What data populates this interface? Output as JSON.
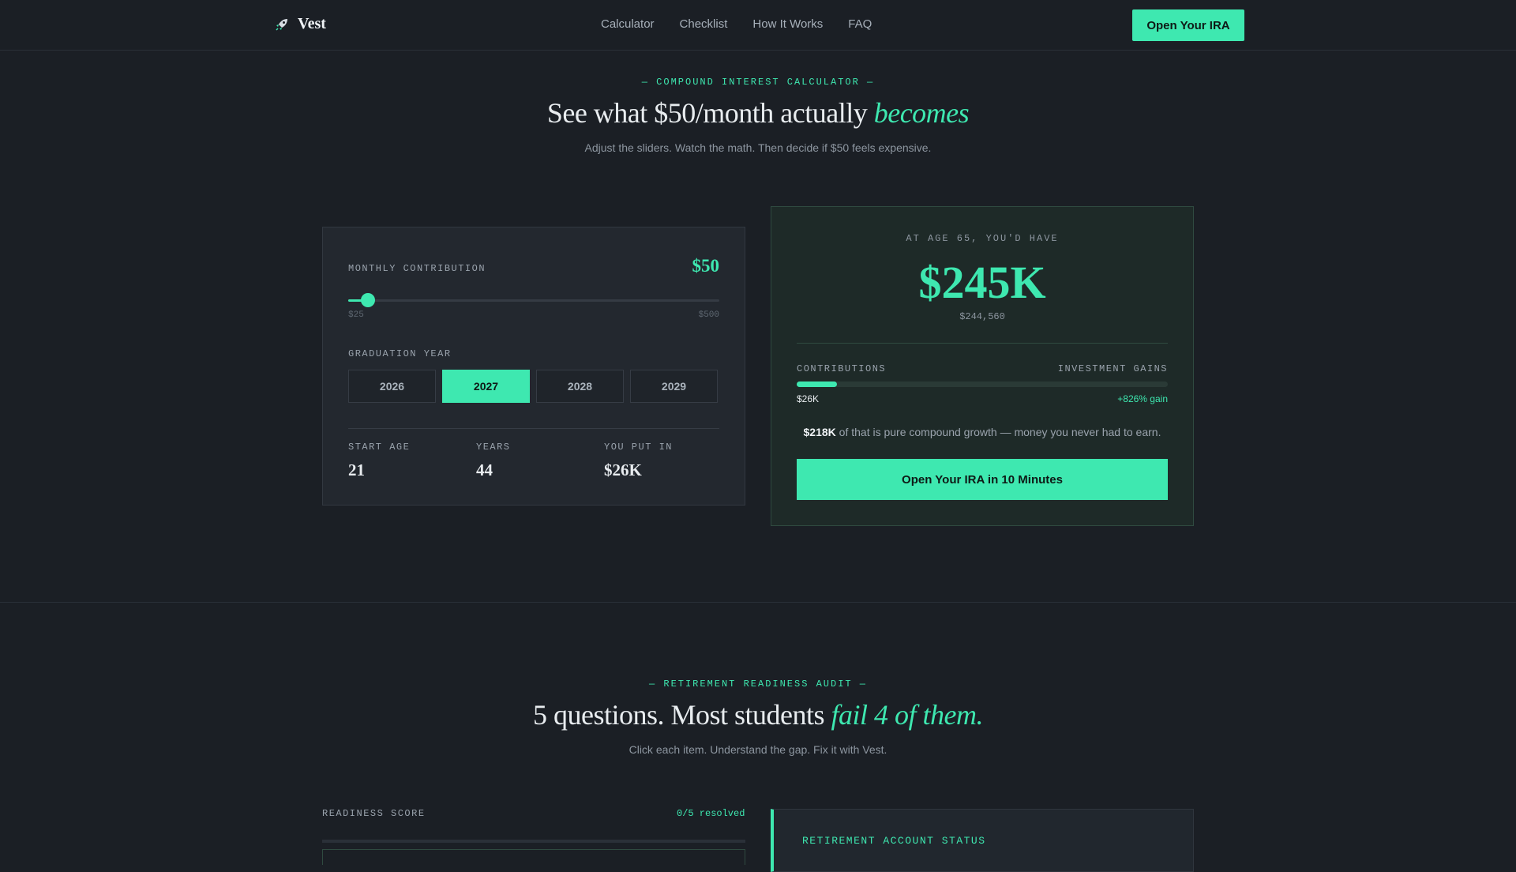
{
  "nav": {
    "brand": "Vest",
    "brand_icon": "rocket-icon",
    "links": [
      "Calculator",
      "Checklist",
      "How It Works",
      "FAQ"
    ],
    "cta": "Open Your IRA"
  },
  "calculator_section": {
    "eyebrow": "— COMPOUND INTEREST CALCULATOR —",
    "headline_prefix": "See what $50/month actually ",
    "headline_emphasis": "becomes",
    "subline": "Adjust the sliders. Watch the math. Then decide if $50 feels expensive."
  },
  "inputs": {
    "contribution_label": "MONTHLY CONTRIBUTION",
    "contribution_value": "$50",
    "slider_min_label": "$25",
    "slider_max_label": "$500",
    "slider_min": 25,
    "slider_max": 500,
    "slider_current": 50,
    "grad_label": "GRADUATION YEAR",
    "years": [
      "2026",
      "2027",
      "2028",
      "2029"
    ],
    "selected_year": "2027",
    "stats": [
      {
        "label": "START AGE",
        "value": "21"
      },
      {
        "label": "YEARS",
        "value": "44"
      },
      {
        "label": "YOU PUT IN",
        "value": "$26K"
      }
    ]
  },
  "result": {
    "eyebrow": "AT AGE 65, YOU'D HAVE",
    "big_value": "$245K",
    "exact_value": "$244,560",
    "contributions_label": "CONTRIBUTIONS",
    "gains_label": "INVESTMENT GAINS",
    "contributions_value": "$26K",
    "gain_value": "+826% gain",
    "contribution_share": 0.108,
    "growth_amount": "$218K",
    "growth_text": " of that is pure compound growth — money you never had to earn.",
    "cta": "Open Your IRA in 10 Minutes"
  },
  "audit_section": {
    "eyebrow": "— RETIREMENT READINESS AUDIT —",
    "headline_prefix": "5 questions. Most students ",
    "headline_emphasis": "fail 4 of them.",
    "subline": "Click each item. Understand the gap. Fix it with Vest.",
    "readiness_label": "READINESS SCORE",
    "readiness_count": "0/5 resolved",
    "readiness_fraction": 0,
    "status_title": "RETIREMENT ACCOUNT STATUS"
  },
  "colors": {
    "background": "#1b1f25",
    "accent": "#3ee8b0",
    "card": "#23282f",
    "result_card": "#1e2a28"
  }
}
